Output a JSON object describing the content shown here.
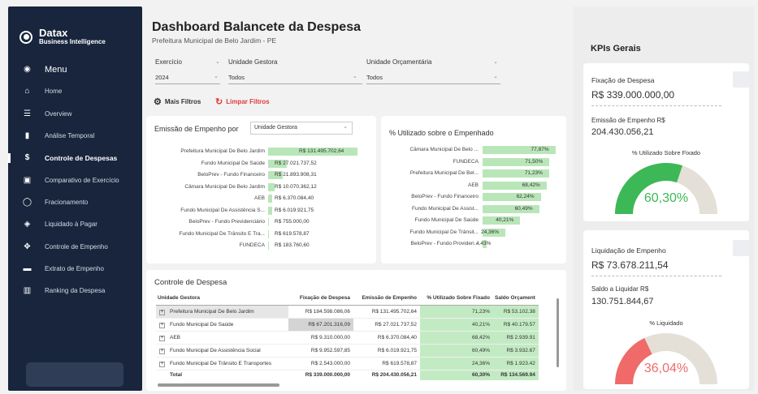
{
  "brand": {
    "name": "Datax",
    "sub": "Business Intelligence"
  },
  "menu": [
    {
      "label": "Menu",
      "icon": "target-icon"
    },
    {
      "label": "Home",
      "icon": "home-icon"
    },
    {
      "label": "Overview",
      "icon": "overview-icon"
    },
    {
      "label": "Análise Temporal",
      "icon": "bar-chart-icon"
    },
    {
      "label": "Controle de Despesas",
      "icon": "dollar-icon"
    },
    {
      "label": "Comparativo de Exercício",
      "icon": "image-icon"
    },
    {
      "label": "Fracionamento",
      "icon": "circle-icon"
    },
    {
      "label": "Liquidado à Pagar",
      "icon": "layers-icon"
    },
    {
      "label": "Controle de Empenho",
      "icon": "move-icon"
    },
    {
      "label": "Extrato de Empenho",
      "icon": "wallet-icon"
    },
    {
      "label": "Ranking da Despesa",
      "icon": "ranking-icon"
    }
  ],
  "header": {
    "title": "Dashboard Balancete da Despesa",
    "subtitle": "Prefeitura Municipal de Belo Jardim - PE"
  },
  "filters": {
    "exercicio": {
      "label": "Exercício",
      "value": "2024"
    },
    "unidade_gestora": {
      "label": "Unidade Gestora",
      "value": "Todos"
    },
    "unidade_orcamentaria": {
      "label": "Unidade Orçamentária",
      "value": "Todos"
    },
    "mais": "Mais Filtros",
    "limpar": "Limpar Filtros"
  },
  "emissao": {
    "title": "Emissão de Empenho por",
    "selector": "Unidade Gestora",
    "rows": [
      {
        "label": "Prefeitura Municipal De Belo Jardim",
        "value": "R$ 131.495.702,64",
        "frac": 1.0
      },
      {
        "label": "Fundo Municipal De Saúde",
        "value": "R$ 27.021.737,52",
        "frac": 0.206
      },
      {
        "label": "BeloPrev - Fundo Financeiro",
        "value": "R$ 21.893.908,31",
        "frac": 0.166
      },
      {
        "label": "Câmara Municipal De Belo Jardim",
        "value": "R$ 10.070.362,12",
        "frac": 0.077
      },
      {
        "label": "AEB",
        "value": "R$ 6.370.084,40",
        "frac": 0.048
      },
      {
        "label": "Fundo Municipal De Assistência S...",
        "value": "R$ 6.019.921,75",
        "frac": 0.046
      },
      {
        "label": "BeloPrev - Fundo Previdenciário",
        "value": "R$ 755.000,00",
        "frac": 0.006
      },
      {
        "label": "Fundo Municipal De Trânsito E Tra...",
        "value": "R$ 619.578,87",
        "frac": 0.005
      },
      {
        "label": "FUNDECA",
        "value": "R$ 183.760,60",
        "frac": 0.001
      }
    ]
  },
  "utilizado": {
    "title": "% Utilizado sobre o Empenhado",
    "rows": [
      {
        "label": "Câmara Municipal De Belo ...",
        "value": "77,87%",
        "frac": 0.7787
      },
      {
        "label": "FUNDECA",
        "value": "71,50%",
        "frac": 0.715
      },
      {
        "label": "Prefeitura Municipal De Bel...",
        "value": "71,23%",
        "frac": 0.7123
      },
      {
        "label": "AEB",
        "value": "68,42%",
        "frac": 0.6842
      },
      {
        "label": "BeloPrev - Fundo Financeiro",
        "value": "62,24%",
        "frac": 0.6224
      },
      {
        "label": "Fundo Municipal De Assist...",
        "value": "60,49%",
        "frac": 0.6049
      },
      {
        "label": "Fundo Municipal De Saúde",
        "value": "40,21%",
        "frac": 0.4021
      },
      {
        "label": "Fundo Municipal De Trânsit...",
        "value": "24,36%",
        "frac": 0.2436
      },
      {
        "label": "BeloPrev - Fundo Providen...",
        "value": "4,43%",
        "frac": 0.0443
      }
    ]
  },
  "controle": {
    "title": "Controle de Despesa",
    "columns": [
      "Unidade Gestora",
      "Fixação de Despesa",
      "Emissão de Empenho",
      "% Utilizado Sobre Fixado",
      "Saldo Orçament"
    ],
    "rows": [
      [
        "Prefeitura Municipal De Belo Jardim",
        "R$ 184.598.086,06",
        "R$ 131.495.702,64",
        "71,23%",
        "R$ 53.102.38"
      ],
      [
        "Fundo Municipal De Saúde",
        "R$ 67.201.316,09",
        "R$ 27.021.737,52",
        "40,21%",
        "R$ 40.179.57"
      ],
      [
        "AEB",
        "R$ 9.310.000,00",
        "R$ 6.370.084,40",
        "68,42%",
        "R$ 2.939.91"
      ],
      [
        "Fundo Municipal De Assistência Social",
        "R$ 9.952.597,85",
        "R$ 6.019.921,75",
        "60,49%",
        "R$ 3.932.67"
      ],
      [
        "Fundo Municipal De Trânsito E Transportes",
        "R$ 2.543.000,00",
        "R$ 619.578,87",
        "24,36%",
        "R$ 1.923.42"
      ]
    ],
    "total": [
      "Total",
      "R$ 339.000.000,00",
      "R$ 204.430.056,21",
      "60,30%",
      "R$ 134.569.94"
    ]
  },
  "kpis": {
    "title": "KPIs Gerais",
    "fixacao_label": "Fixação de Despesa",
    "fixacao_value": "R$ 339.000.000,00",
    "emissao_label": "Emissão de Empenho R$",
    "emissao_value": "204.430.056,21",
    "gauge1_label": "% Utilizado Sobre Fixado",
    "gauge1_value": "60,30%",
    "gauge1_frac": 0.603,
    "liquidacao_label": "Liquidação de Empenho",
    "liquidacao_value": "R$ 73.678.211,54",
    "saldo_label": "Saldo a Liquidar R$",
    "saldo_value": "130.751.844,67",
    "gauge2_label": "% Liquidado",
    "gauge2_value": "36,04%",
    "gauge2_frac": 0.3604
  },
  "colors": {
    "sidebar": "#18253d",
    "bar": "#b9e6b9",
    "green": "#3cb857",
    "red": "#f06a6a",
    "gauge_bg": "#e4e0d8"
  }
}
